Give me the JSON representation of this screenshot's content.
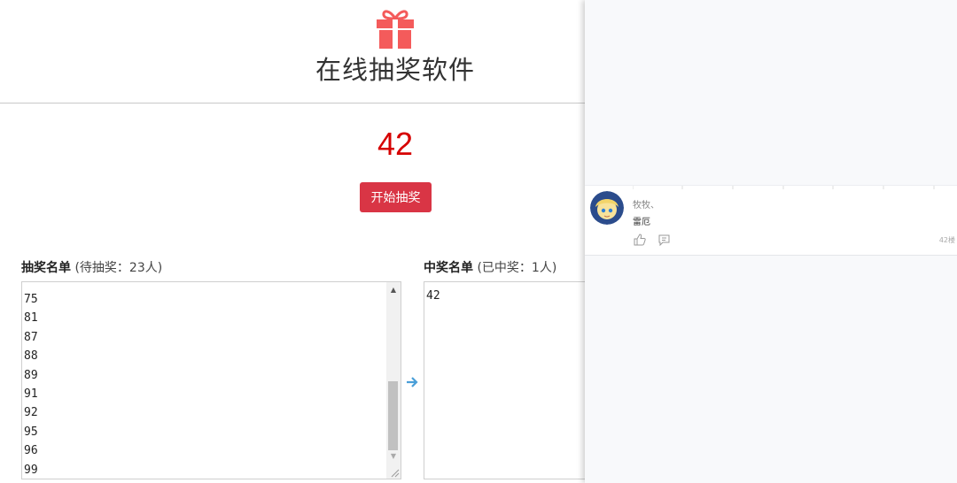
{
  "app": {
    "title": "在线抽奖软件",
    "current_number": "42",
    "draw_button_label": "开始抽奖",
    "arrow_icon": "arrow-right-icon",
    "gift_icon": "gift-icon",
    "colors": {
      "accent": "#d93545",
      "number": "#d60000",
      "gift": "#f45b5b",
      "arrow": "#4a9fd8"
    }
  },
  "pool": {
    "title": "抽奖名单",
    "meta": "(待抽奖：23人)",
    "items": [
      "75",
      "81",
      "87",
      "88",
      "89",
      "91",
      "92",
      "95",
      "96",
      "99"
    ]
  },
  "winners": {
    "title": "中奖名单",
    "meta": "(已中奖：1人)",
    "items": [
      "42"
    ]
  },
  "comment": {
    "user": "牧牧、",
    "text": "雷厄",
    "floor": "42楼",
    "like_icon": "thumbs-up-icon",
    "reply_icon": "reply-icon"
  }
}
